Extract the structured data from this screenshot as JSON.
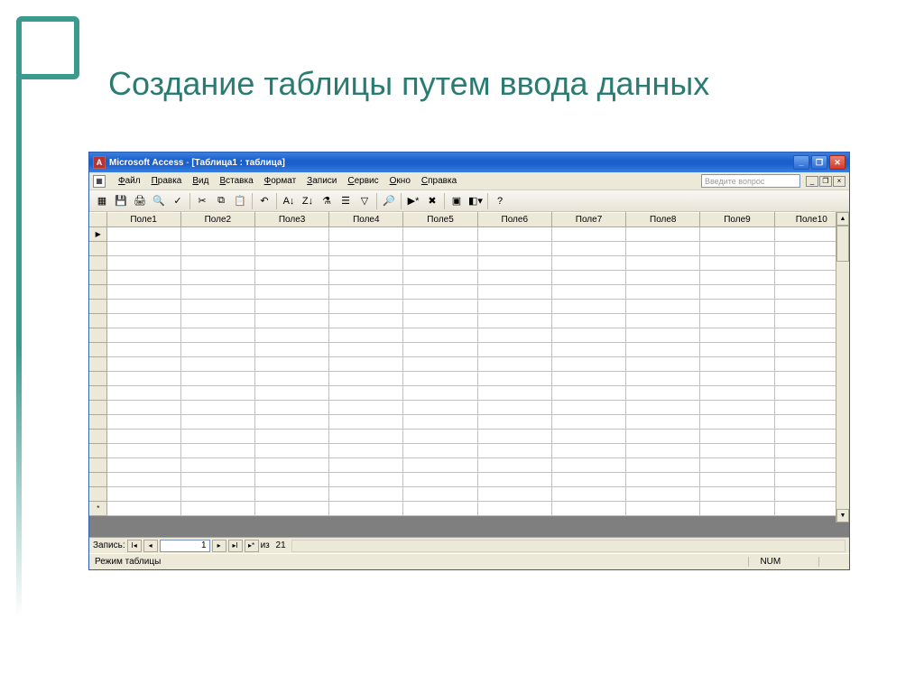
{
  "slide": {
    "title": "Создание таблицы путем ввода данных"
  },
  "window": {
    "app_name": "Microsoft Access",
    "doc_title": "[Таблица1 : таблица]",
    "help_placeholder": "Введите вопрос"
  },
  "menus": [
    "Файл",
    "Правка",
    "Вид",
    "Вставка",
    "Формат",
    "Записи",
    "Сервис",
    "Окно",
    "Справка"
  ],
  "toolbar_icons": [
    {
      "name": "view-icon",
      "glyph": "▦"
    },
    {
      "name": "save-icon",
      "glyph": "💾"
    },
    {
      "name": "print-icon",
      "glyph": "🖨"
    },
    {
      "name": "print-preview-icon",
      "glyph": "🔍"
    },
    {
      "name": "spellcheck-icon",
      "glyph": "✓"
    },
    {
      "name": "sep"
    },
    {
      "name": "cut-icon",
      "glyph": "✂"
    },
    {
      "name": "copy-icon",
      "glyph": "⧉"
    },
    {
      "name": "paste-icon",
      "glyph": "📋"
    },
    {
      "name": "sep"
    },
    {
      "name": "undo-icon",
      "glyph": "↶"
    },
    {
      "name": "sep"
    },
    {
      "name": "sort-asc-icon",
      "glyph": "A↓"
    },
    {
      "name": "sort-desc-icon",
      "glyph": "Z↓"
    },
    {
      "name": "filter-selection-icon",
      "glyph": "⚗"
    },
    {
      "name": "filter-form-icon",
      "glyph": "☰"
    },
    {
      "name": "apply-filter-icon",
      "glyph": "▽"
    },
    {
      "name": "sep"
    },
    {
      "name": "find-icon",
      "glyph": "🔎"
    },
    {
      "name": "sep"
    },
    {
      "name": "new-record-icon",
      "glyph": "▶*"
    },
    {
      "name": "delete-record-icon",
      "glyph": "✖"
    },
    {
      "name": "sep"
    },
    {
      "name": "database-window-icon",
      "glyph": "▣"
    },
    {
      "name": "new-object-icon",
      "glyph": "◧▾"
    },
    {
      "name": "sep"
    },
    {
      "name": "help-icon",
      "glyph": "?"
    }
  ],
  "columns": [
    "Поле1",
    "Поле2",
    "Поле3",
    "Поле4",
    "Поле5",
    "Поле6",
    "Поле7",
    "Поле8",
    "Поле9",
    "Поле10"
  ],
  "record_nav": {
    "label": "Запись:",
    "current": "1",
    "of_label": "из",
    "total": "21"
  },
  "statusbar": {
    "mode": "Режим таблицы",
    "num": "NUM"
  }
}
